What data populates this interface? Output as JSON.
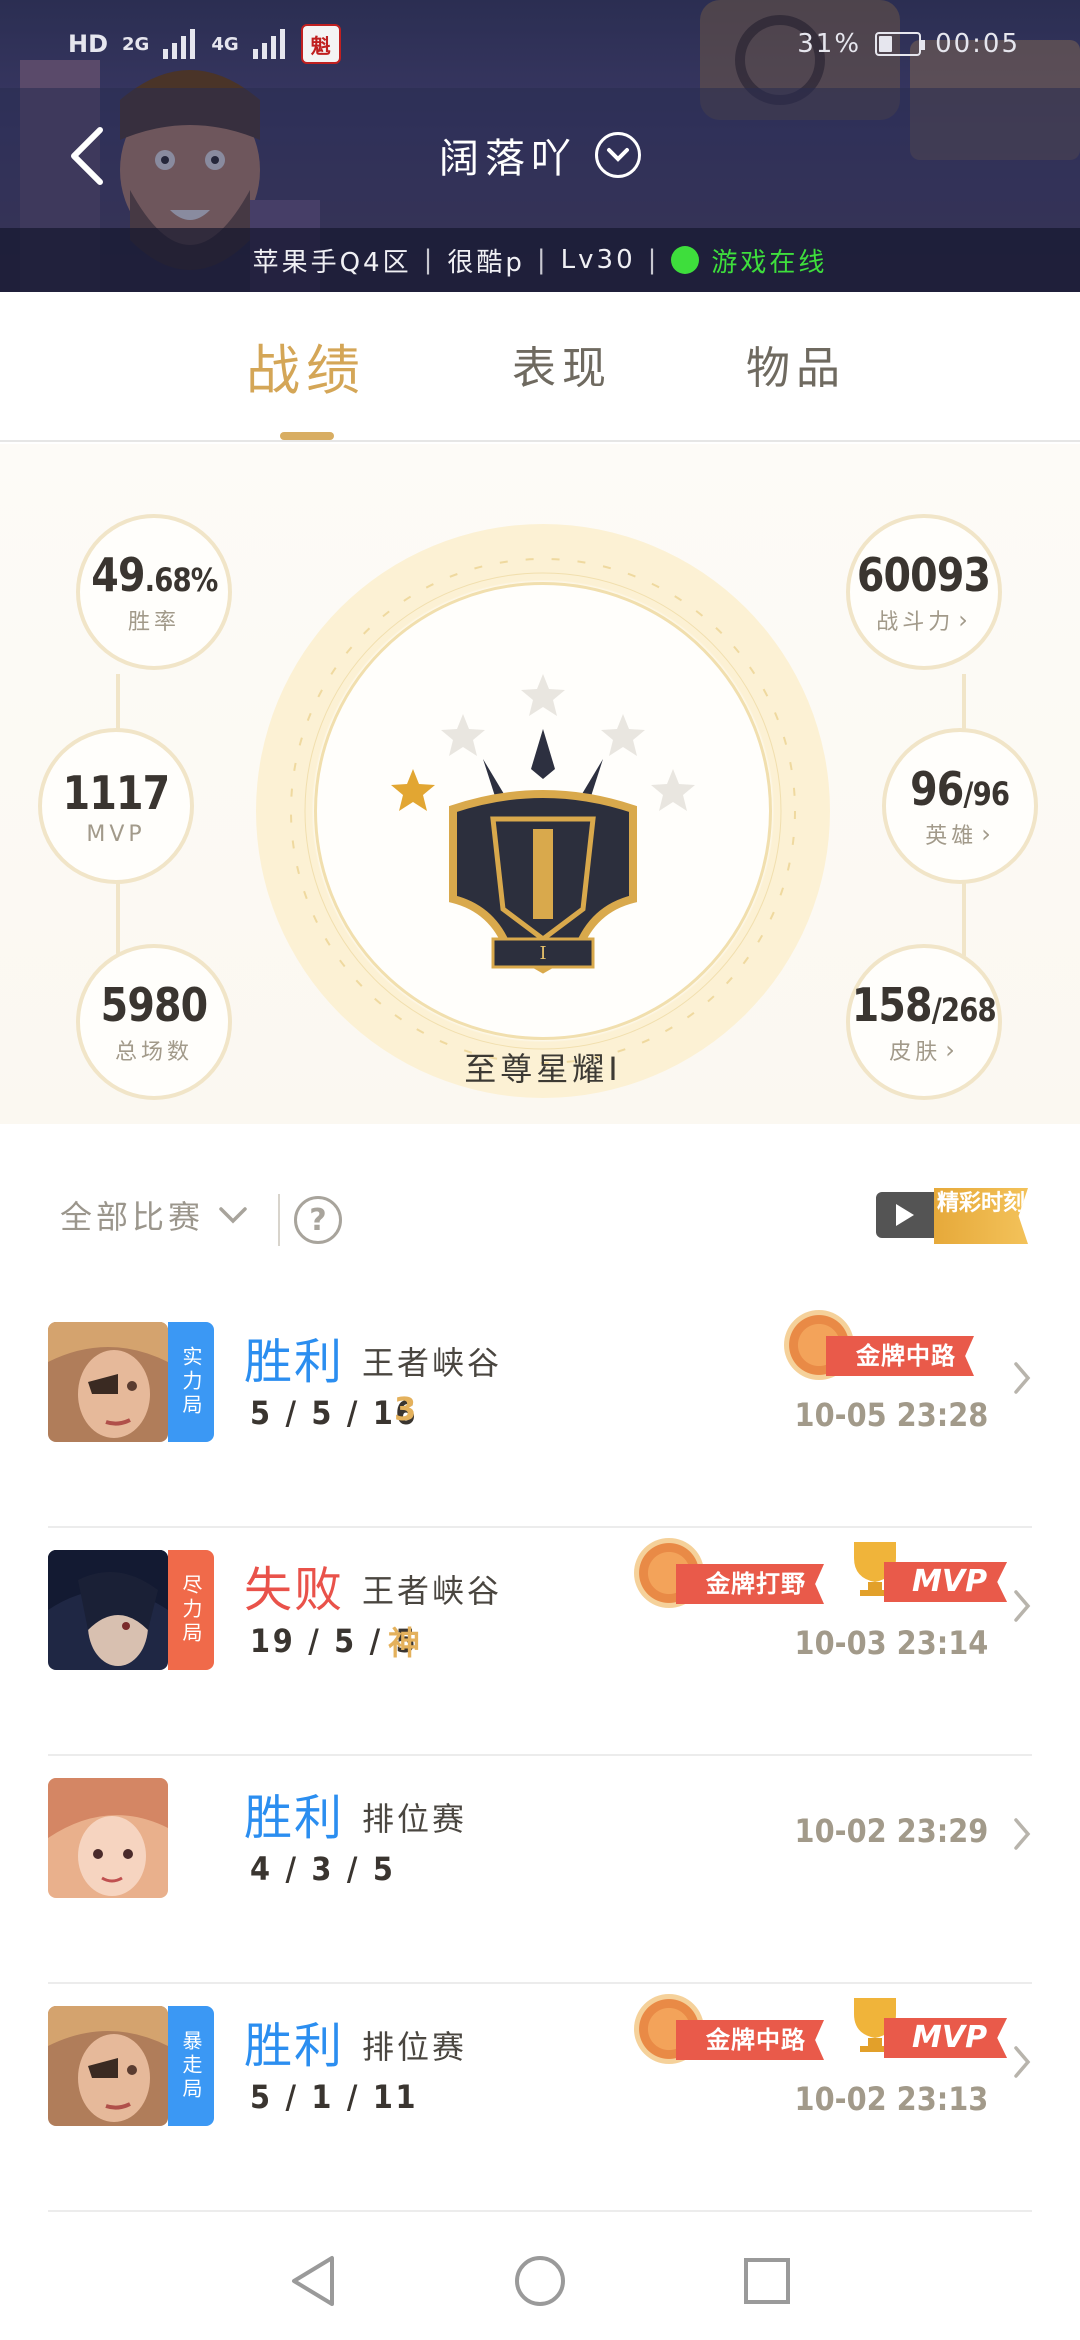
{
  "status_bar": {
    "left_badges": [
      "HD",
      "2",
      "2G",
      "4G"
    ],
    "app_icon": "魁",
    "battery_percent": "31%",
    "battery_level": 0.31,
    "time": "00:05"
  },
  "header": {
    "title": "阔落吖",
    "info": {
      "server": "苹果手Q4区",
      "tag": "很酷p",
      "level": "Lv30",
      "status": "游戏在线"
    },
    "colors": {
      "online": "#3ede3c"
    }
  },
  "tabs": [
    {
      "label": "战绩",
      "active": true
    },
    {
      "label": "表现",
      "active": false
    },
    {
      "label": "物品",
      "active": false
    }
  ],
  "stats": {
    "win_rate": {
      "main": "49",
      "small": ".68%",
      "label": "胜率"
    },
    "mvp": {
      "value": "1117",
      "label": "MVP"
    },
    "total_games": {
      "value": "5980",
      "label": "总场数"
    },
    "power": {
      "value": "60093",
      "label": "战斗力"
    },
    "heroes": {
      "main": "96",
      "small": "/96",
      "label": "英雄"
    },
    "skins": {
      "main": "158",
      "small": "/268",
      "label": "皮肤"
    },
    "rank": {
      "name": "至尊星耀I",
      "stars_filled": 1,
      "stars_total": 5
    }
  },
  "filter": {
    "label": "全部比赛",
    "highlight_label": "精彩时刻"
  },
  "matches": [
    {
      "mode": "实力局",
      "mode_color": "blue",
      "result": "胜利",
      "result_type": "win",
      "map": "王者峡谷",
      "kda": "5 / 5 / 16",
      "kda_badge": "3",
      "badges": [
        {
          "type": "medal",
          "text": "金牌中路"
        }
      ],
      "time": "10-05 23:28"
    },
    {
      "mode": "尽力局",
      "mode_color": "red",
      "result": "失败",
      "result_type": "lose",
      "map": "王者峡谷",
      "kda": "19 / 5 / 5",
      "kda_badge": "神",
      "badges": [
        {
          "type": "medal",
          "text": "金牌打野"
        },
        {
          "type": "mvp",
          "text": "MVP"
        }
      ],
      "time": "10-03 23:14"
    },
    {
      "mode": "",
      "mode_color": "",
      "result": "胜利",
      "result_type": "win",
      "map": "排位赛",
      "kda": "4 / 3 / 5",
      "kda_badge": "",
      "badges": [],
      "time": "10-02 23:29"
    },
    {
      "mode": "暴走局",
      "mode_color": "blue",
      "result": "胜利",
      "result_type": "win",
      "map": "排位赛",
      "kda": "5 / 1 / 11",
      "kda_badge": "",
      "badges": [
        {
          "type": "medal",
          "text": "金牌中路"
        },
        {
          "type": "mvp",
          "text": "MVP"
        }
      ],
      "time": "10-02 23:13"
    }
  ],
  "nav": {
    "back": "back-icon",
    "home": "home-icon",
    "recent": "recent-apps-icon"
  }
}
